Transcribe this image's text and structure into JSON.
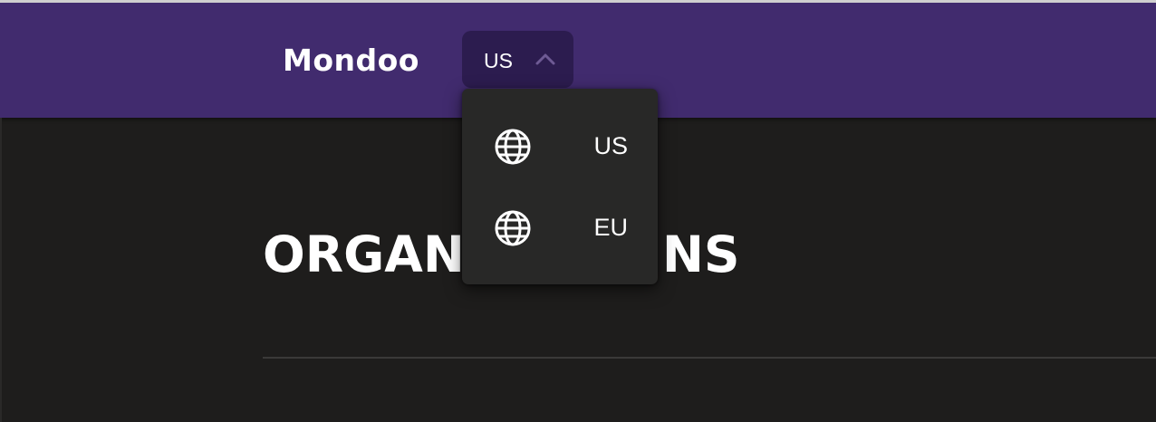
{
  "header": {
    "logo_text": "Mondoo",
    "region_select": {
      "value": "US",
      "icon": "chevron-up-icon"
    }
  },
  "main": {
    "title_visible_left": "ORGAN",
    "title_visible_right": "NS"
  },
  "dropdown": {
    "options": [
      {
        "label": "US",
        "icon": "globe-icon"
      },
      {
        "label": "EU",
        "icon": "globe-icon"
      }
    ]
  },
  "colors": {
    "header_bg": "#412b6e",
    "select_bg": "#2c1c4f",
    "page_bg": "#1e1d1c",
    "dropdown_bg": "#282827",
    "text": "#ffffff"
  }
}
